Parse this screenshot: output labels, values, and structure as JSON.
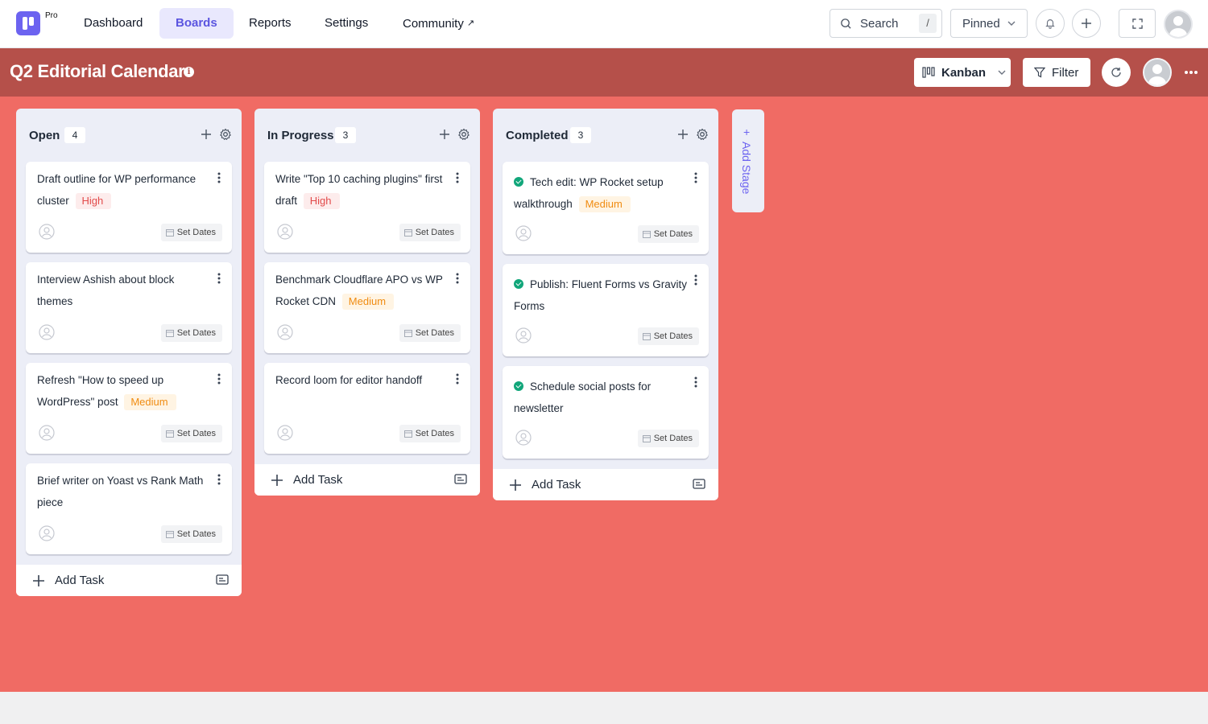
{
  "nav": {
    "pro_label": "Pro",
    "items": [
      {
        "label": "Dashboard"
      },
      {
        "label": "Boards"
      },
      {
        "label": "Reports"
      },
      {
        "label": "Settings"
      },
      {
        "label": "Community"
      }
    ],
    "active": "Boards",
    "search_label": "Search",
    "search_shortcut": "/",
    "pinned_label": "Pinned"
  },
  "board": {
    "title": "Q2 Editorial Calendar",
    "view_label": "Kanban",
    "filter_label": "Filter",
    "header_color": "#b5504a",
    "background_color": "#f06b64"
  },
  "columns": [
    {
      "name": "Open",
      "count": "4",
      "add_task_label": "Add Task",
      "tasks": [
        {
          "title": "Draft outline for WP performance cluster",
          "priority": "High",
          "set_dates": "Set Dates"
        },
        {
          "title": "Interview Ashish about block themes",
          "priority": "",
          "set_dates": "Set Dates"
        },
        {
          "title": "Refresh \"How to speed up WordPress\" post",
          "priority": "Medium",
          "set_dates": "Set Dates"
        },
        {
          "title": "Brief writer on Yoast vs Rank Math piece",
          "priority": "",
          "set_dates": "Set Dates"
        }
      ]
    },
    {
      "name": "In Progress",
      "count": "3",
      "add_task_label": "Add Task",
      "tasks": [
        {
          "title": "Write \"Top 10 caching plugins\" first draft",
          "priority": "High",
          "set_dates": "Set Dates"
        },
        {
          "title": "Benchmark Cloudflare APO vs WP Rocket CDN",
          "priority": "Medium",
          "set_dates": "Set Dates"
        },
        {
          "title": "Record loom for editor handoff",
          "priority": "",
          "set_dates": "Set Dates"
        }
      ]
    },
    {
      "name": "Completed",
      "count": "3",
      "add_task_label": "Add Task",
      "tasks": [
        {
          "title": "Tech edit: WP Rocket setup walkthrough",
          "priority": "Medium",
          "done": true,
          "set_dates": "Set Dates"
        },
        {
          "title": "Publish: Fluent Forms vs Gravity Forms",
          "priority": "",
          "done": true,
          "set_dates": "Set Dates"
        },
        {
          "title": "Schedule social posts for newsletter",
          "priority": "",
          "done": true,
          "set_dates": "Set Dates"
        }
      ]
    }
  ],
  "add_stage_label": "Add Stage",
  "icons": [
    "search-icon",
    "chevron-down-icon",
    "bell-icon",
    "plus-icon",
    "fullscreen-icon",
    "info-icon",
    "kanban-icon",
    "filter-icon",
    "refresh-icon",
    "more-icon",
    "gear-icon",
    "user-icon",
    "calendar-icon",
    "card-icon",
    "check-circle-icon"
  ]
}
